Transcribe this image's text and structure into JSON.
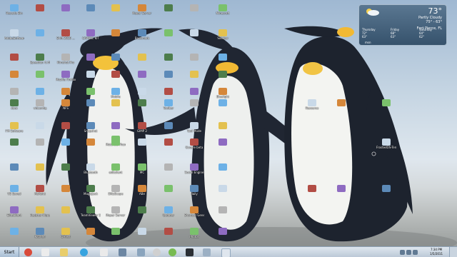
{
  "desktop_icons": [
    "Recycle Bin",
    "",
    "",
    "",
    "",
    "Mopar Server Status Ch...",
    "",
    "Minecraft",
    "",
    "AdobeSoftware",
    "",
    "Shift 2010 ...",
    "CAPNOL KIT",
    "",
    "Shrine",
    "Bookmark",
    "",
    "Sidebar",
    "",
    "Speedfan 4.44",
    "Rimshot Pro",
    "",
    "",
    "",
    "",
    "",
    "",
    "",
    "",
    "",
    "",
    "",
    "",
    "",
    "",
    "",
    "",
    "",
    "Mobile",
    "",
    "Bluelight",
    "",
    "",
    "",
    "",
    "",
    "",
    "",
    "",
    "",
    "",
    "",
    "",
    "",
    "",
    "",
    "",
    "",
    "",
    "",
    "",
    "",
    "",
    "",
    "",
    "",
    "",
    "",
    "",
    "",
    "",
    "",
    "",
    "",
    "",
    "",
    "",
    "",
    "",
    "",
    "",
    "",
    "",
    "",
    "",
    "",
    "",
    "",
    "",
    "",
    "",
    "",
    "",
    "",
    "",
    "",
    "",
    "",
    "",
    "",
    "",
    "",
    "",
    "",
    "",
    "",
    "",
    "",
    "",
    "",
    "",
    "",
    "",
    ""
  ],
  "visible_labels": {
    "recycle_bin": "Recycle Bin",
    "mopar_server": "Mopar Server Status Ch...",
    "minecraft": "Minecraft",
    "adobe": "AdobeSoftware",
    "shift": "Shift 2010 ...",
    "capnol": "CAPNOL KIT",
    "bookmark": "Bookmark",
    "sidebar": "Sidebar",
    "speedfan": "Speedfan 4.44",
    "rimshot": "Rimshot Pro",
    "bluelight": "Bluelight",
    "mobile": "Mobile",
    "motorola": "Motorola Phone Tools",
    "tool_mode": "Tool Mode",
    "google_beta": "Google beta",
    "social_engine": "Social Engine",
    "daily": "daily",
    "register": "Register Mopar Ne...",
    "teamviewer": "TeamViewer 5",
    "mopar_status": "Mopar Server Status Ch...",
    "updater": "Updater",
    "shortcut": "Shortcut Generator",
    "photos": "Photos",
    "froster": "FrostedOS-TermC",
    "mspaint": "MsPaint",
    "elite_client": "EliteClient",
    "kitchen": "Kitchen",
    "oatest": "OATest",
    "magicjack": "MagicJack",
    "blitzscape": "BlitzScape",
    "vs_saved": "VS Saved",
    "abe": "ABe",
    "edit_client": "editclient",
    "bluetooth": "Bluetooth",
    "gimp": "GIMP 2",
    "mozilla": "Mozilla Firefox",
    "snapshot": "Snapshot",
    "fm_software": "FM Software",
    "xbox": "xbox",
    "vid_config": "vidconfig",
    "toolbar": "Toolbar",
    "nfs": "NFS",
    "mc": "MC",
    "resource": "Resource"
  },
  "weather": {
    "temperature": "73°",
    "condition": "Partly Cloudy",
    "hi_lo": "75° - 63°",
    "location": "Fort Pierce, FL",
    "forecast": [
      {
        "day": "Thursday",
        "hi": "72°",
        "lo": "63°"
      },
      {
        "day": "Friday",
        "hi": "68°",
        "lo": "63°"
      },
      {
        "day": "Saturday",
        "hi": "64°",
        "lo": "62°"
      }
    ],
    "source": "msn"
  },
  "taskbar": {
    "start_label": "Start",
    "time": "7:34 PM",
    "date": "1/5/2011"
  }
}
